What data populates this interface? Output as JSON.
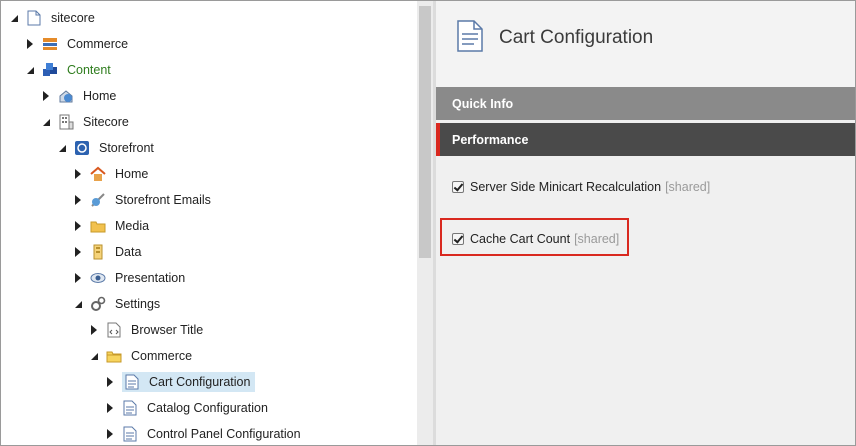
{
  "tree": {
    "items": [
      {
        "label": "sitecore",
        "state": "open",
        "icon": "sitecore-icon",
        "level": 0
      },
      {
        "label": "Commerce",
        "state": "closed",
        "icon": "commerce-icon",
        "level": 1
      },
      {
        "label": "Content",
        "state": "open",
        "icon": "content-icon",
        "level": 1
      },
      {
        "label": "Home",
        "state": "closed",
        "icon": "home-globe-icon",
        "level": 2
      },
      {
        "label": "Sitecore",
        "state": "open",
        "icon": "building-icon",
        "level": 2
      },
      {
        "label": "Storefront",
        "state": "open",
        "icon": "storefront-icon",
        "level": 3
      },
      {
        "label": "Home",
        "state": "closed",
        "icon": "home-icon",
        "level": 4
      },
      {
        "label": "Storefront Emails",
        "state": "closed",
        "icon": "email-icon",
        "level": 4
      },
      {
        "label": "Media",
        "state": "closed",
        "icon": "media-folder-icon",
        "level": 4
      },
      {
        "label": "Data",
        "state": "closed",
        "icon": "data-icon",
        "level": 4
      },
      {
        "label": "Presentation",
        "state": "closed",
        "icon": "eye-icon",
        "level": 4
      },
      {
        "label": "Settings",
        "state": "open",
        "icon": "gears-icon",
        "level": 4
      },
      {
        "label": "Browser Title",
        "state": "closed",
        "icon": "document-code-icon",
        "level": 5
      },
      {
        "label": "Commerce",
        "state": "open",
        "icon": "folder-icon",
        "level": 5
      },
      {
        "label": "Cart Configuration",
        "state": "closed",
        "icon": "document-icon",
        "level": 6,
        "selected": true
      },
      {
        "label": "Catalog Configuration",
        "state": "closed",
        "icon": "document-icon",
        "level": 6
      },
      {
        "label": "Control Panel Configuration",
        "state": "closed",
        "icon": "document-icon",
        "level": 6
      }
    ]
  },
  "editor": {
    "title": "Cart Configuration",
    "sections": {
      "quick_info": "Quick Info",
      "performance": "Performance"
    },
    "fields": [
      {
        "label": "Server Side Minicart Recalculation",
        "tag": "[shared]",
        "checked": true
      },
      {
        "label": "Cache Cart Count",
        "tag": "[shared]",
        "checked": true
      }
    ]
  },
  "colors": {
    "accent_red": "#d9281f",
    "selection": "#d3e7f4",
    "content_green": "#2f7d1e"
  }
}
